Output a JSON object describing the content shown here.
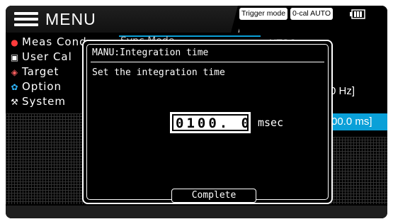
{
  "header": {
    "title": "MENU",
    "trigger_mode_label": "Trigger mode",
    "cal_mode_label": "0-cal AUTO"
  },
  "side_menu": {
    "items": [
      {
        "label": "Meas Cond",
        "icon": "ring-icon",
        "icon_color": "#ff3b3b"
      },
      {
        "label": "User Cal",
        "icon": "card-icon",
        "icon_color": "#ffffff"
      },
      {
        "label": "Target",
        "icon": "target-icon",
        "icon_color": "#ff6060"
      },
      {
        "label": "Option",
        "icon": "gear-icon",
        "icon_color": "#2fb8ff"
      },
      {
        "label": "System",
        "icon": "tools-icon",
        "icon_color": "#ffffff"
      }
    ]
  },
  "background": {
    "sync_mode_label": "Sync Mode",
    "ntsc_label": "NTSC",
    "hz_value": "0 Hz]",
    "ms_value": "00.0 ms]"
  },
  "dialog": {
    "title": "MANU:Integration time",
    "message": "Set the integration time",
    "value": "0100. 0",
    "unit": "msec",
    "complete_label": "Complete"
  },
  "colors": {
    "accent": "#0aa0d8",
    "background": "#000000",
    "text": "#ffffff"
  }
}
